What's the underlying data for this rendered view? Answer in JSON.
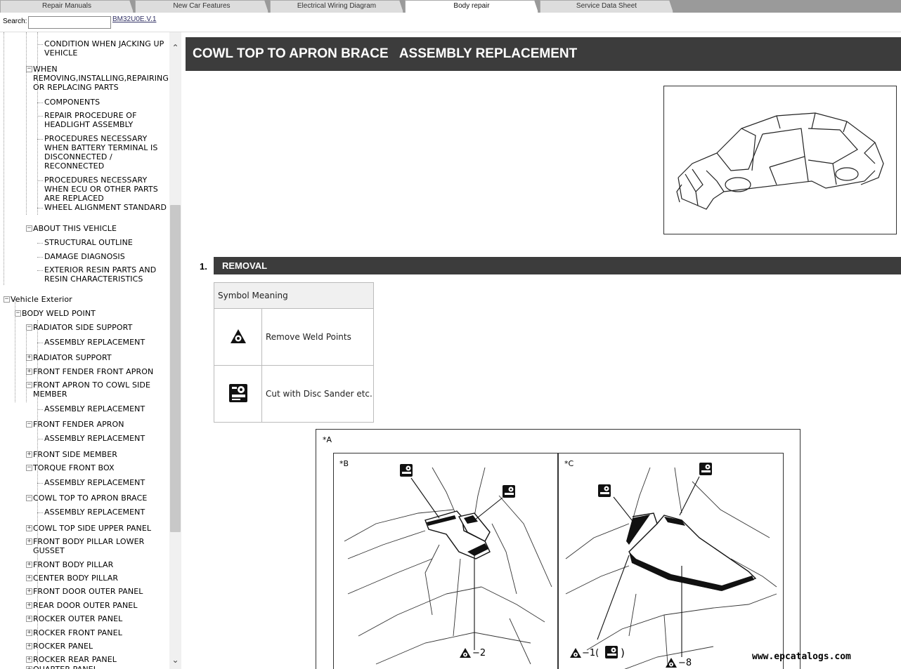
{
  "tabs": [
    {
      "label": "Repair Manuals",
      "active": false
    },
    {
      "label": "New Car Features",
      "active": false
    },
    {
      "label": "Electrical Wiring Diagram",
      "active": false
    },
    {
      "label": "Body repair",
      "active": true
    },
    {
      "label": "Service Data Sheet",
      "active": false
    }
  ],
  "search": {
    "label": "Search:",
    "value": "",
    "doc_id": "BM32U0E.V.1"
  },
  "tree": [
    {
      "text": "CONDITION WHEN JACKING UP\nVEHICLE",
      "level": 3,
      "toggle": ""
    },
    {
      "text": "WHEN\nREMOVING,INSTALLING,REPAIRING\nOR REPLACING PARTS",
      "level": 2,
      "toggle": "−"
    },
    {
      "text": "COMPONENTS",
      "level": 3,
      "toggle": ""
    },
    {
      "text": "REPAIR PROCEDURE OF\nHEADLIGHT ASSEMBLY",
      "level": 3,
      "toggle": ""
    },
    {
      "text": "PROCEDURES NECESSARY\nWHEN BATTERY TERMINAL IS\nDISCONNECTED /\nRECONNECTED",
      "level": 3,
      "toggle": ""
    },
    {
      "text": "PROCEDURES NECESSARY\nWHEN ECU OR OTHER PARTS\nARE REPLACED",
      "level": 3,
      "toggle": ""
    },
    {
      "text": "WHEEL ALIGNMENT STANDARD",
      "level": 3,
      "toggle": ""
    },
    {
      "text": "ABOUT THIS VEHICLE",
      "level": 2,
      "toggle": "−"
    },
    {
      "text": "STRUCTURAL OUTLINE",
      "level": 3,
      "toggle": ""
    },
    {
      "text": "DAMAGE DIAGNOSIS",
      "level": 3,
      "toggle": ""
    },
    {
      "text": "EXTERIOR RESIN PARTS AND\nRESIN CHARACTERISTICS",
      "level": 3,
      "toggle": ""
    },
    {
      "text": "Vehicle Exterior",
      "level": 0,
      "toggle": "−"
    },
    {
      "text": "BODY WELD POINT",
      "level": 1,
      "toggle": "−"
    },
    {
      "text": "RADIATOR SIDE SUPPORT",
      "level": 2,
      "toggle": "−"
    },
    {
      "text": "ASSEMBLY REPLACEMENT",
      "level": 3,
      "toggle": ""
    },
    {
      "text": "RADIATOR SUPPORT",
      "level": 2,
      "toggle": "+"
    },
    {
      "text": "FRONT FENDER FRONT APRON",
      "level": 2,
      "toggle": "+"
    },
    {
      "text": "FRONT APRON TO COWL SIDE\nMEMBER",
      "level": 2,
      "toggle": "−"
    },
    {
      "text": "ASSEMBLY REPLACEMENT",
      "level": 3,
      "toggle": ""
    },
    {
      "text": "FRONT FENDER APRON",
      "level": 2,
      "toggle": "−"
    },
    {
      "text": "ASSEMBLY REPLACEMENT",
      "level": 3,
      "toggle": ""
    },
    {
      "text": "FRONT SIDE MEMBER",
      "level": 2,
      "toggle": "+"
    },
    {
      "text": "TORQUE FRONT BOX",
      "level": 2,
      "toggle": "−"
    },
    {
      "text": "ASSEMBLY REPLACEMENT",
      "level": 3,
      "toggle": ""
    },
    {
      "text": "COWL TOP TO APRON BRACE",
      "level": 2,
      "toggle": "−"
    },
    {
      "text": "ASSEMBLY REPLACEMENT",
      "level": 3,
      "toggle": ""
    },
    {
      "text": "COWL TOP SIDE UPPER PANEL",
      "level": 2,
      "toggle": "+"
    },
    {
      "text": "FRONT BODY PILLAR LOWER\nGUSSET",
      "level": 2,
      "toggle": "+"
    },
    {
      "text": "FRONT BODY PILLAR",
      "level": 2,
      "toggle": "+"
    },
    {
      "text": "CENTER BODY PILLAR",
      "level": 2,
      "toggle": "+"
    },
    {
      "text": "FRONT DOOR OUTER PANEL",
      "level": 2,
      "toggle": "+"
    },
    {
      "text": "REAR DOOR OUTER PANEL",
      "level": 2,
      "toggle": "+"
    },
    {
      "text": "ROCKER OUTER PANEL",
      "level": 2,
      "toggle": "+"
    },
    {
      "text": "ROCKER FRONT PANEL",
      "level": 2,
      "toggle": "+"
    },
    {
      "text": "ROCKER PANEL",
      "level": 2,
      "toggle": "+"
    },
    {
      "text": "ROCKER REAR PANEL",
      "level": 2,
      "toggle": "+"
    },
    {
      "text": "QUARTER PANEL",
      "level": 2,
      "toggle": "+"
    }
  ],
  "main": {
    "title": "COWL TOP TO APRON BRACE   ASSEMBLY REPLACEMENT",
    "section_number": "1.",
    "section_title": "REMOVAL",
    "symbol_table": {
      "header": "Symbol Meaning",
      "rows": [
        {
          "icon": "weld-point-icon",
          "meaning": "Remove Weld Points"
        },
        {
          "icon": "disc-sander-icon",
          "meaning": "Cut with Disc Sander etc."
        }
      ]
    },
    "diagram": {
      "label_a": "*A",
      "label_b": "*B",
      "label_c": "*C",
      "callout_b": "−2",
      "callout_c1": "−1(",
      "callout_c1_close": ")",
      "callout_c2": "−8"
    }
  },
  "watermark": "www.epcatalogs.com"
}
